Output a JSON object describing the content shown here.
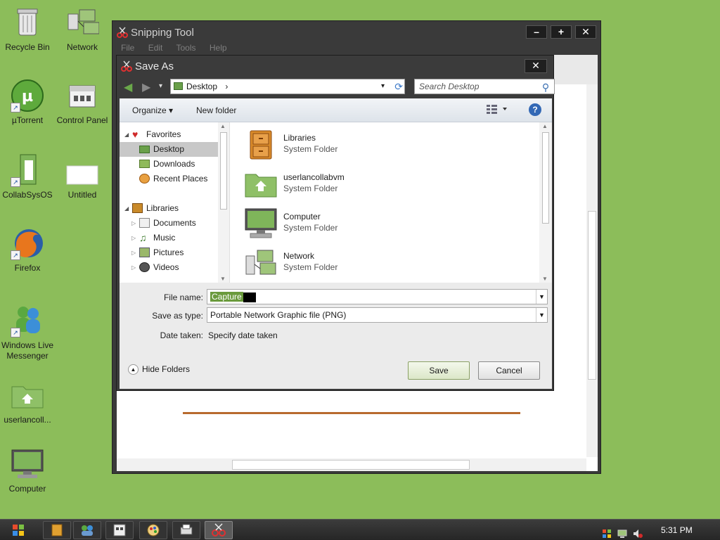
{
  "desktop": {
    "icons": [
      {
        "label": "Recycle Bin"
      },
      {
        "label": "Network"
      },
      {
        "label": "µTorrent"
      },
      {
        "label": "Control Panel"
      },
      {
        "label": "CollabSysOS"
      },
      {
        "label": "Untitled"
      },
      {
        "label": "Firefox"
      },
      {
        "label": "Windows Live Messenger"
      },
      {
        "label": "userlancoll..."
      },
      {
        "label": "Computer"
      }
    ]
  },
  "snipping_tool": {
    "title": "Snipping Tool",
    "menu": [
      "File",
      "Edit",
      "Tools",
      "Help"
    ],
    "buttons": {
      "minimize": "–",
      "maximize": "+",
      "close": "✕"
    }
  },
  "save_as": {
    "title": "Save As",
    "close": "✕",
    "address": {
      "location": "Desktop",
      "separator": "›",
      "dropdown": "▾"
    },
    "search": {
      "placeholder": "Search Desktop"
    },
    "toolbar": {
      "organize": "Organize ▾",
      "new_folder": "New folder",
      "help": "?"
    },
    "nav": {
      "favorites_label": "Favorites",
      "favorites": [
        "Desktop",
        "Downloads",
        "Recent Places"
      ],
      "libraries_label": "Libraries",
      "libraries": [
        "Documents",
        "Music",
        "Pictures",
        "Videos"
      ]
    },
    "files": [
      {
        "name": "Libraries",
        "type": "System Folder"
      },
      {
        "name": "userlancollabvm",
        "type": "System Folder"
      },
      {
        "name": "Computer",
        "type": "System Folder"
      },
      {
        "name": "Network",
        "type": "System Folder"
      }
    ],
    "form": {
      "file_name_label": "File name:",
      "file_name_value": "Capture",
      "save_type_label": "Save as type:",
      "save_type_value": "Portable Network Graphic file (PNG)",
      "date_label": "Date taken:",
      "date_value": "Specify date taken"
    },
    "hide_folders": "Hide Folders",
    "save_button": "Save",
    "cancel_button": "Cancel"
  },
  "taskbar": {
    "clock": "5:31 PM"
  },
  "colors": {
    "desktop_bg": "#8cbd5a",
    "selection": "#6a9a3c",
    "window_frame": "#3b3b3b"
  }
}
